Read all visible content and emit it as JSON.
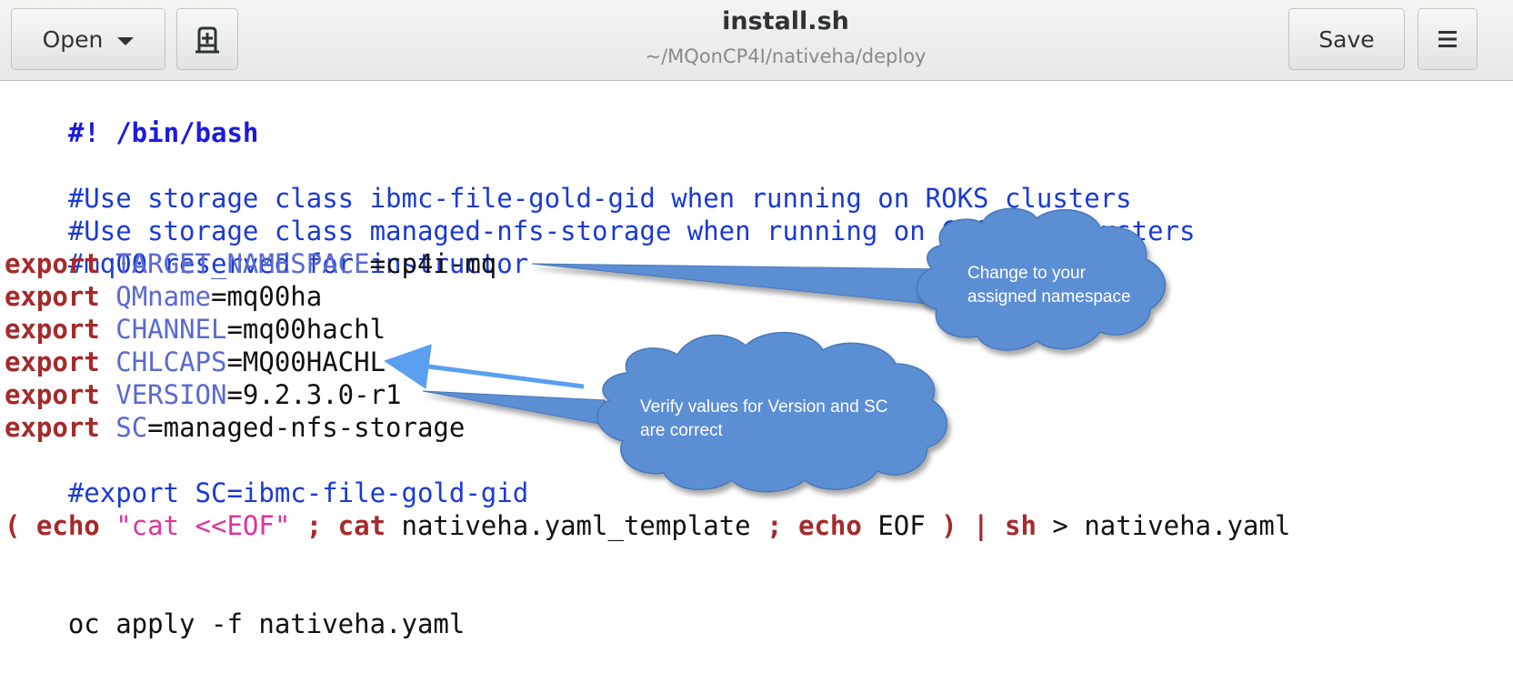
{
  "header": {
    "open_label": "Open",
    "open_caret_icon": "chevron-down-icon",
    "new_tab_icon": "new-document-icon",
    "title": "install.sh",
    "subtitle": "~/MQonCP4I/nativeha/deploy",
    "save_label": "Save",
    "menu_icon": "hamburger-menu-icon"
  },
  "editor": {
    "lines": {
      "l1": "#! /bin/bash",
      "l3": "#Use storage class ibmc-file-gold-gid when running on ROKS clusters",
      "l4": "#Use storage class managed-nfs-storage when running on CoC PoT clusters",
      "l5": "#mq00 reserved for instructor",
      "l6": {
        "kw": "export",
        "var": "TARGET_NAMESPACE",
        "val": "=cp4i-mq"
      },
      "l7": {
        "kw": "export",
        "var": "QMname",
        "val": "=mq00ha"
      },
      "l8": {
        "kw": "export",
        "var": "CHANNEL",
        "val": "=mq00hachl"
      },
      "l9": {
        "kw": "export",
        "var": "CHLCAPS",
        "val": "=MQ00HACHL"
      },
      "l10": {
        "kw": "export",
        "var": "VERSION",
        "val": "=9.2.3.0-r1"
      },
      "l11": {
        "kw": "export",
        "var": "SC",
        "val": "=managed-nfs-storage"
      },
      "l12": "#export SC=ibmc-file-gold-gid",
      "l14": {
        "p1": "( ",
        "echo1": "echo",
        "str": " \"cat <<EOF\"",
        "semi1": " ;",
        "cat": " cat",
        "tmpl": " nativeha.yaml_template",
        "semi2": " ;",
        "echo2": " echo",
        "eof": " EOF",
        "close": " ) |",
        "sh": " sh",
        "redir": " > nativeha.yaml"
      },
      "l16": "oc apply -f nativeha.yaml"
    }
  },
  "callouts": {
    "namespace": {
      "line1": "Change to your",
      "line2": "assigned namespace"
    },
    "version": {
      "line1": "Verify values for Version and SC",
      "line2": "are correct"
    }
  },
  "colors": {
    "callout_fill": "#5b8ed4",
    "callout_stroke": "#4a78ba",
    "arrow": "#5a9ff0"
  }
}
